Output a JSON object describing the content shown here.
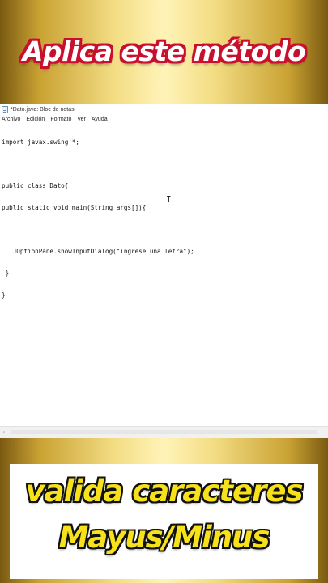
{
  "overlay": {
    "headline": "Aplica este método",
    "bottom_line1": "valida caracteres",
    "bottom_line2": "Mayus/Minus",
    "headline_fill": "#ffffff",
    "headline_outline": "#c8102e",
    "bottom_fill": "#f7e11a",
    "bottom_outline": "#111111"
  },
  "window": {
    "title": "*Dato.java: Bloc de notas",
    "icon": "notepad-icon",
    "menu": [
      "Archivo",
      "Edición",
      "Formato",
      "Ver",
      "Ayuda"
    ]
  },
  "editor": {
    "lines": [
      "import javax.swing.*;",
      "",
      "public class Dato{",
      "public static void main(String args[]){",
      "",
      "   JOptionPane.showInputDialog(\"ingrese una letra\");",
      " }",
      "}"
    ],
    "cursor_glyph": "I"
  },
  "scrollbar": {
    "left_arrow": "‹"
  }
}
